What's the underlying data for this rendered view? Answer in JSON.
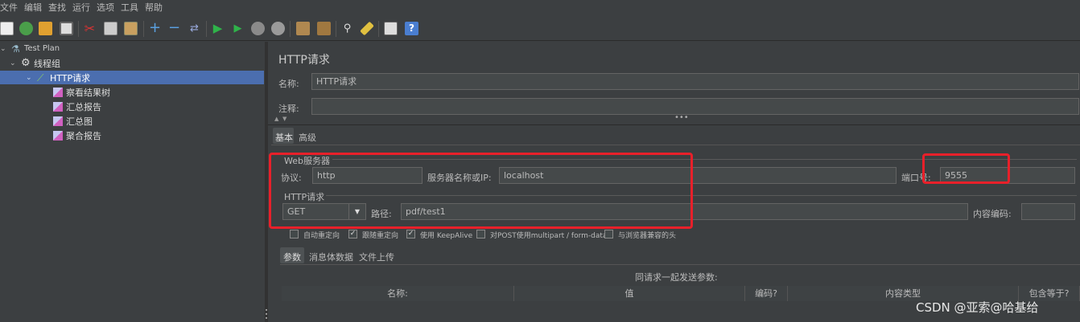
{
  "menu": [
    "文件",
    "编辑",
    "查找",
    "运行",
    "选项",
    "工具",
    "帮助"
  ],
  "tree": {
    "test_plan": "Test Plan",
    "thread_group": "线程组",
    "http_request": "HTTP请求",
    "listeners": [
      "察看结果树",
      "汇总报告",
      "汇总图",
      "聚合报告"
    ]
  },
  "panel": {
    "title": "HTTP请求",
    "name_label": "名称:",
    "name_value": "HTTP请求",
    "comment_label": "注释:",
    "comment_value": "",
    "tabs": [
      "基本",
      "高级"
    ],
    "web_server_title": "Web服务器",
    "protocol_label": "协议:",
    "protocol_value": "http",
    "server_label": "服务器名称或IP:",
    "server_value": "localhost",
    "port_label": "端口号:",
    "port_value": "9555",
    "http_request_title": "HTTP请求",
    "method_value": "GET",
    "path_label": "路径:",
    "path_value": "pdf/test1",
    "encoding_label": "内容编码:",
    "encoding_value": "",
    "checkboxes": [
      {
        "label": "自动重定向",
        "checked": false
      },
      {
        "label": "跟随重定向",
        "checked": true
      },
      {
        "label": "使用 KeepAlive",
        "checked": true
      },
      {
        "label": "对POST使用multipart / form-data",
        "checked": false
      },
      {
        "label": "与浏览器兼容的头",
        "checked": false
      }
    ],
    "param_tabs": [
      "参数",
      "消息体数据",
      "文件上传"
    ],
    "params_caption": "同请求一起发送参数:",
    "columns": [
      "名称:",
      "值",
      "编码?",
      "内容类型",
      "包含等于?"
    ]
  },
  "watermark": "CSDN @亚索@哈基给",
  "colors": {
    "highlight": "#e8202a",
    "selection": "#4b6eaf"
  }
}
